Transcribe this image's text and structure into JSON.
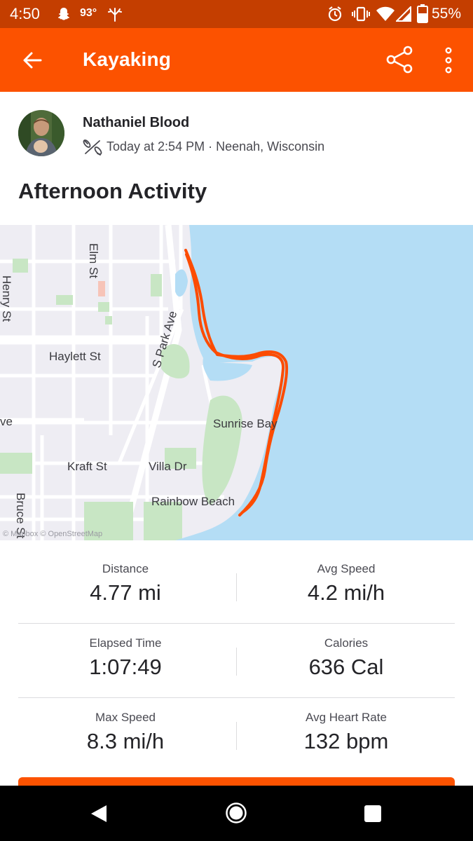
{
  "status_bar": {
    "time": "4:50",
    "temperature": "93°",
    "battery": "55%"
  },
  "app_bar": {
    "title": "Kayaking"
  },
  "athlete": {
    "name": "Nathaniel Blood",
    "meta": "Today at 2:54 PM · Neenah, Wisconsin"
  },
  "activity": {
    "title": "Afternoon Activity"
  },
  "map": {
    "labels": {
      "elm": "Elm St",
      "henry": "Henry St",
      "park": "S Park Ave",
      "haylett": "Haylett St",
      "sunrise": "Sunrise Bay",
      "ave_edge": "ve",
      "kraft": "Kraft St",
      "villa": "Villa Dr",
      "rainbow": "Rainbow Beach",
      "bruce": "Bruce St"
    },
    "attribution": "© Mapbox © OpenStreetMap",
    "colors": {
      "water": "#b4ddf5",
      "land": "#eeedf3",
      "park": "#c8e6c4",
      "route": "#fc4c02"
    }
  },
  "stats": [
    {
      "label": "Distance",
      "value": "4.77 mi"
    },
    {
      "label": "Avg Speed",
      "value": "4.2 mi/h"
    },
    {
      "label": "Elapsed Time",
      "value": "1:07:49"
    },
    {
      "label": "Calories",
      "value": "636 Cal"
    },
    {
      "label": "Max Speed",
      "value": "8.3 mi/h"
    },
    {
      "label": "Avg Heart Rate",
      "value": "132 bpm"
    }
  ],
  "icons": {
    "back": "arrow-left-icon",
    "share": "share-icon",
    "overflow": "more-vert-icon",
    "sport": "kayak-icon",
    "nav_back": "triangle-back-icon",
    "nav_home": "circle-home-icon",
    "nav_recents": "square-recents-icon"
  },
  "brand_color": "#fc5200"
}
